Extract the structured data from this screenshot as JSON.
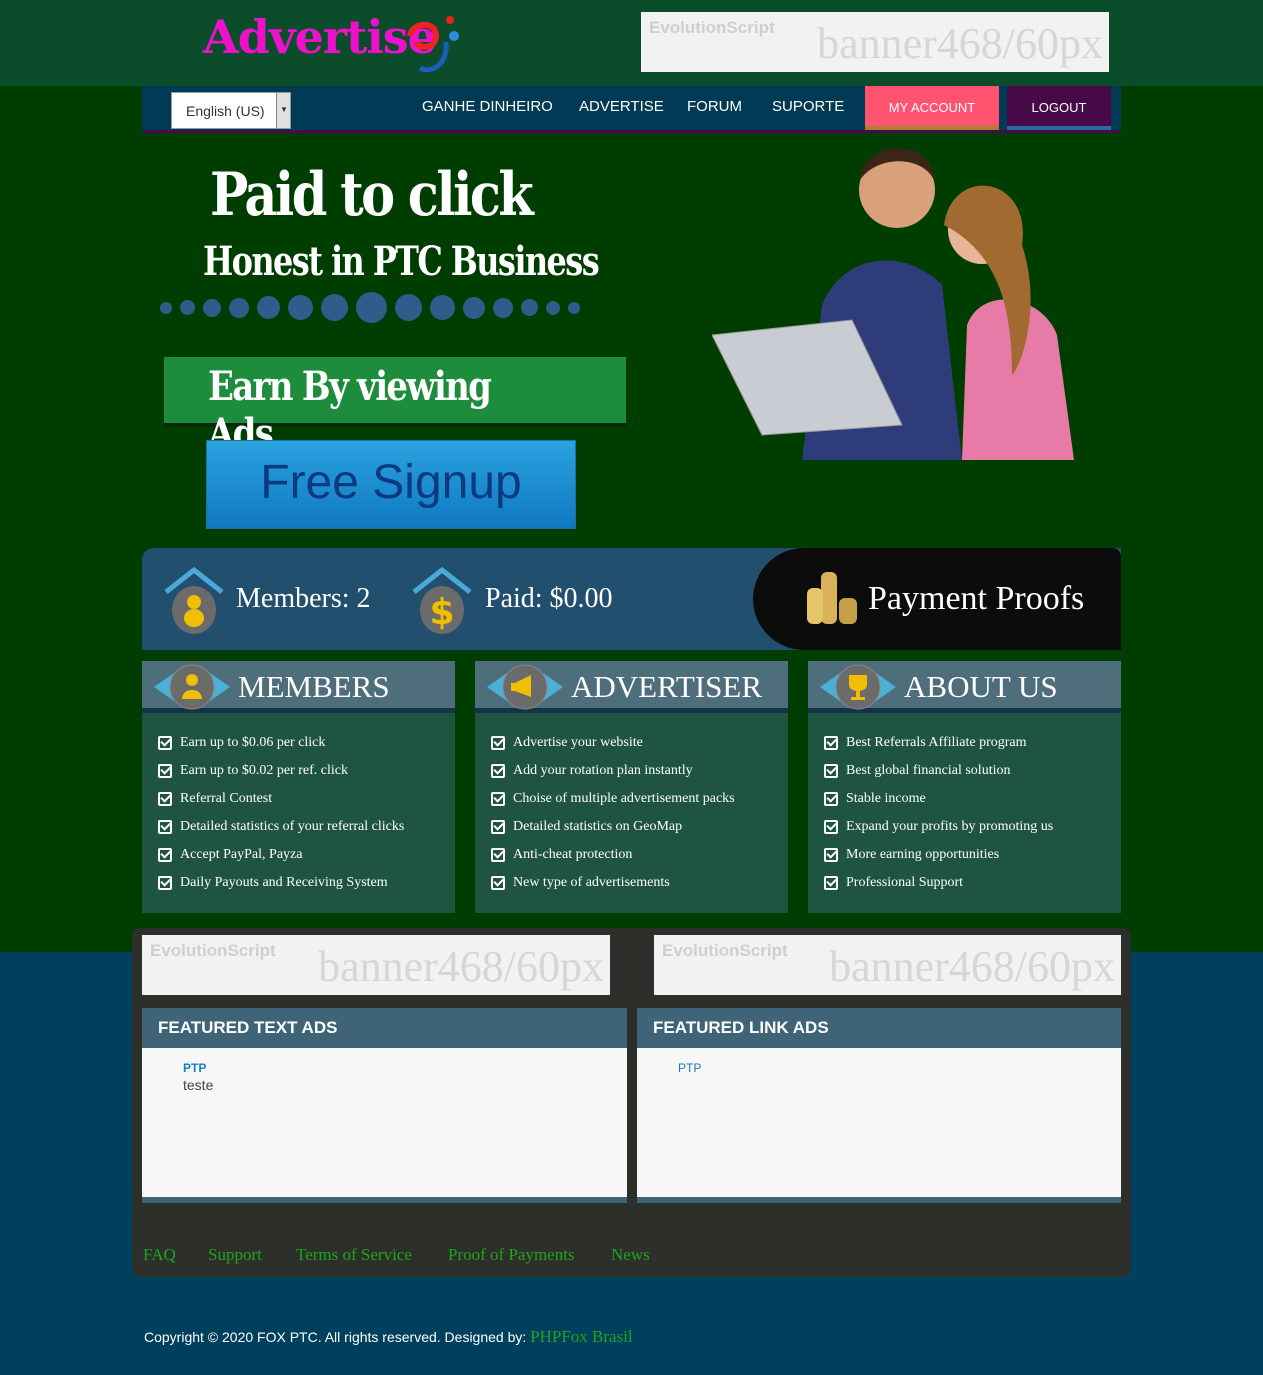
{
  "header": {
    "logo_text": "Advertise",
    "banner_brand": "EvolutionScript",
    "banner_text": "banner468/60px"
  },
  "nav": {
    "language": "English (US)",
    "links": [
      "GANHE DINHEIRO",
      "ADVERTISE",
      "FORUM",
      "SUPORTE"
    ],
    "my_account": "MY ACCOUNT",
    "logout": "LOGOUT"
  },
  "hero": {
    "title": "Paid to click",
    "subtitle": "Honest in PTC Business",
    "earn": "Earn  By viewing Ads",
    "signup": "Free Signup"
  },
  "stats": {
    "members": "Members: 2",
    "paid": "Paid: $0.00",
    "proofs": "Payment Proofs"
  },
  "boxes": [
    {
      "title": "MEMBERS",
      "icon": "user-icon",
      "items": [
        "Earn up to $0.06 per click",
        "Earn up to $0.02 per ref. click",
        "Referral Contest",
        "Detailed statistics of your referral clicks",
        "Accept PayPal, Payza",
        "Daily Payouts and Receiving System"
      ]
    },
    {
      "title": "ADVERTISER",
      "icon": "megaphone-icon",
      "items": [
        "Advertise your website",
        "Add your rotation plan instantly",
        "Choise of multiple advertisement packs",
        "Detailed statistics on GeoMap",
        "Anti-cheat protection",
        "New type of advertisements"
      ]
    },
    {
      "title": "ABOUT US",
      "icon": "trophy-icon",
      "items": [
        "Best Referrals Affiliate program",
        "Best global financial solution",
        "Stable income",
        "Expand your profits by promoting us",
        "More earning opportunities",
        "Professional Support"
      ]
    }
  ],
  "featured": {
    "text_ads": {
      "title": "FEATURED TEXT ADS",
      "ad_title": "PTP",
      "ad_desc": "teste"
    },
    "link_ads": {
      "title": "FEATURED LINK ADS",
      "ad_title": "PTP"
    }
  },
  "footer": {
    "links": [
      "FAQ",
      "Support",
      "Terms of Service",
      "Proof of Payments",
      "News"
    ],
    "copyright": "Copyright © 2020 FOX PTC. All rights reserved. Designed by: ",
    "designer": "PHPFox Brasil"
  },
  "colors": {
    "accent_pink": "#ff5370",
    "logout_purple": "#470a46",
    "link_green": "#1da51d"
  }
}
